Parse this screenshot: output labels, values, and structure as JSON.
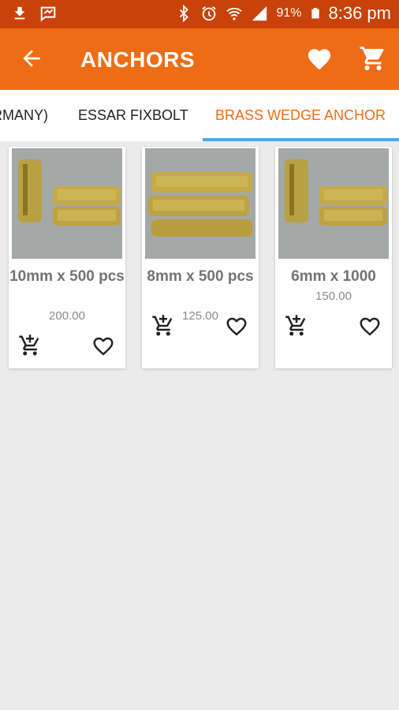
{
  "status_bar": {
    "battery_percent": "91%",
    "time": "8:36 pm",
    "icons": [
      "download-icon",
      "messenger-icon",
      "bluetooth-icon",
      "alarm-icon",
      "wifi-icon",
      "signal-icon",
      "battery-icon"
    ]
  },
  "app_bar": {
    "title": "ANCHORS",
    "icons": [
      "back-arrow-icon",
      "heart-icon",
      "cart-icon"
    ]
  },
  "tabs": [
    {
      "label": "RMANY)"
    },
    {
      "label": "ESSAR FIXBOLT"
    },
    {
      "label": "BRASS WEDGE ANCHOR",
      "selected": true
    }
  ],
  "products": [
    {
      "name": "10mm x 500 pcs",
      "price": "200.00"
    },
    {
      "name": "8mm x 500 pcs",
      "price": "125.00"
    },
    {
      "name": "6mm x 1000",
      "price": "150.00"
    }
  ],
  "colors": {
    "status_bar": "#c8420a",
    "app_bar": "#ef6c16",
    "tab_selected": "#ef6c16",
    "tab_indicator": "#55a4e8",
    "background": "#ebebeb"
  }
}
